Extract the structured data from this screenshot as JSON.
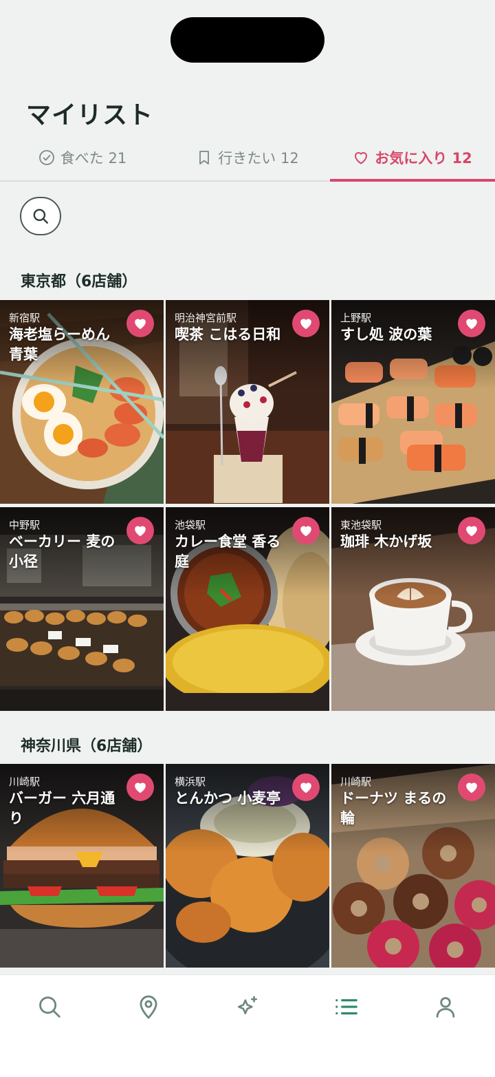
{
  "page": {
    "title": "マイリスト"
  },
  "tabs": [
    {
      "label": "食べた 21"
    },
    {
      "label": "行きたい 12"
    },
    {
      "label": "お気に入り 12"
    }
  ],
  "active_tab": "お気に入り 12",
  "accent_color": "#d9466a",
  "sections": [
    {
      "title": "東京都（6店舗）",
      "shops": [
        {
          "station": "新宿駅",
          "name": "海老塩らーめん 青葉"
        },
        {
          "station": "明治神宮前駅",
          "name": "喫茶 こはる日和"
        },
        {
          "station": "上野駅",
          "name": "すし処 波の葉"
        },
        {
          "station": "中野駅",
          "name": "ベーカリー 麦の小径"
        },
        {
          "station": "池袋駅",
          "name": "カレー食堂 香る庭"
        },
        {
          "station": "東池袋駅",
          "name": "珈琲 木かげ坂"
        }
      ]
    },
    {
      "title": "神奈川県（6店舗）",
      "shops": [
        {
          "station": "川崎駅",
          "name": "バーガー 六月通り"
        },
        {
          "station": "横浜駅",
          "name": "とんかつ 小麦亭"
        },
        {
          "station": "川崎駅",
          "name": "ドーナツ まるの輪"
        }
      ]
    }
  ],
  "icons": {
    "search": "search-icon",
    "favorite": "heart-icon",
    "nav": [
      "search-icon",
      "map-pin-icon",
      "sparkle-icon",
      "list-icon",
      "user-icon"
    ]
  }
}
